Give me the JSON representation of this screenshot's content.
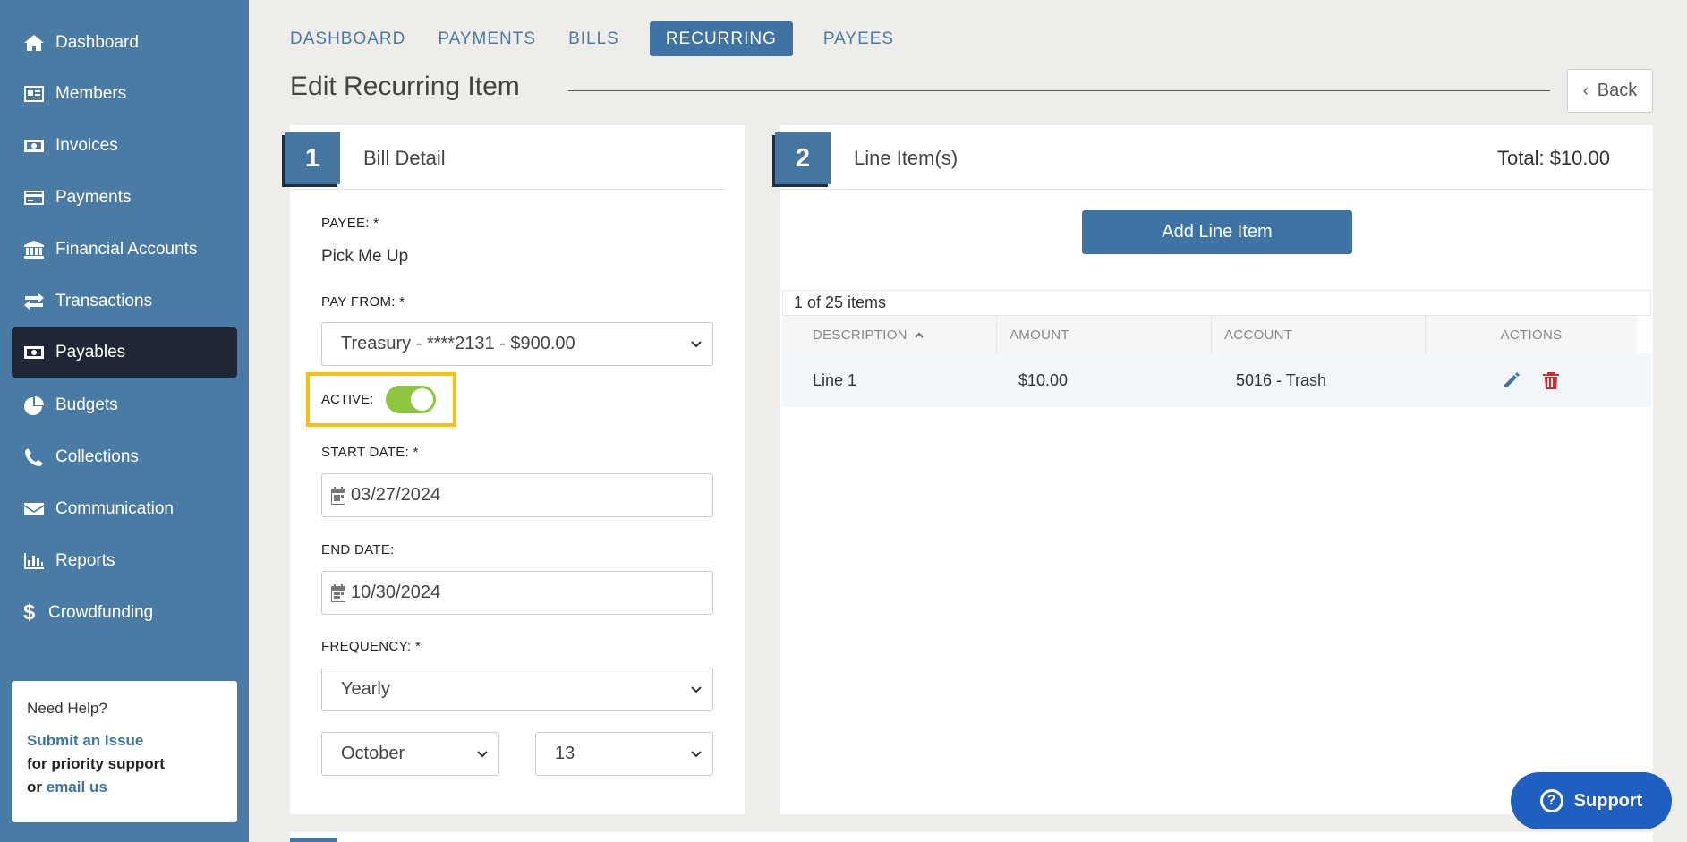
{
  "sidebar": {
    "items": [
      {
        "label": "Dashboard",
        "icon": "home-icon"
      },
      {
        "label": "Members",
        "icon": "id-card-icon"
      },
      {
        "label": "Invoices",
        "icon": "money-bill-icon"
      },
      {
        "label": "Payments",
        "icon": "credit-card-icon"
      },
      {
        "label": "Financial Accounts",
        "icon": "bank-icon"
      },
      {
        "label": "Transactions",
        "icon": "exchange-icon"
      },
      {
        "label": "Payables",
        "icon": "money-bill-icon",
        "active": true
      },
      {
        "label": "Budgets",
        "icon": "pie-chart-icon"
      },
      {
        "label": "Collections",
        "icon": "phone-icon"
      },
      {
        "label": "Communication",
        "icon": "envelope-icon"
      },
      {
        "label": "Reports",
        "icon": "bar-chart-icon"
      },
      {
        "label": "Crowdfunding",
        "icon": "dollar-icon"
      }
    ],
    "help": {
      "title": "Need Help?",
      "submit_link": "Submit an Issue",
      "priority_text": "for priority support",
      "or_text": "or",
      "email_link": "email us"
    }
  },
  "topnav": {
    "tabs": [
      "DASHBOARD",
      "PAYMENTS",
      "BILLS",
      "RECURRING",
      "PAYEES"
    ],
    "active": "RECURRING"
  },
  "page": {
    "title": "Edit Recurring Item",
    "back_label": "Back"
  },
  "bill_detail": {
    "step": "1",
    "heading": "Bill Detail",
    "payee_label": "PAYEE: *",
    "payee_value": "Pick Me Up",
    "pay_from_label": "PAY FROM: *",
    "pay_from_value": "Treasury - ****2131 - $900.00",
    "active_label": "ACTIVE:",
    "active_on": true,
    "start_date_label": "START DATE: *",
    "start_date_value": "03/27/2024",
    "end_date_label": "END DATE:",
    "end_date_value": "10/30/2024",
    "frequency_label": "FREQUENCY: *",
    "frequency_value": "Yearly",
    "month_value": "October",
    "day_value": "13"
  },
  "line_items": {
    "step": "2",
    "heading": "Line Item(s)",
    "total": "Total: $10.00",
    "add_label": "Add Line Item",
    "count_text": "1 of 25 items",
    "columns": [
      "DESCRIPTION",
      "AMOUNT",
      "ACCOUNT",
      "ACTIONS"
    ],
    "rows": [
      {
        "description": "Line 1",
        "amount": "$10.00",
        "account": "5016 - Trash"
      }
    ]
  },
  "support": {
    "label": "Support"
  },
  "colors": {
    "sidebar": "#4a7ba4",
    "sidebar_active": "#1f2737",
    "accent": "#3f73a3",
    "toggle_on": "#8dc63f",
    "highlight": "#f4c20d",
    "delete": "#d9262b"
  }
}
